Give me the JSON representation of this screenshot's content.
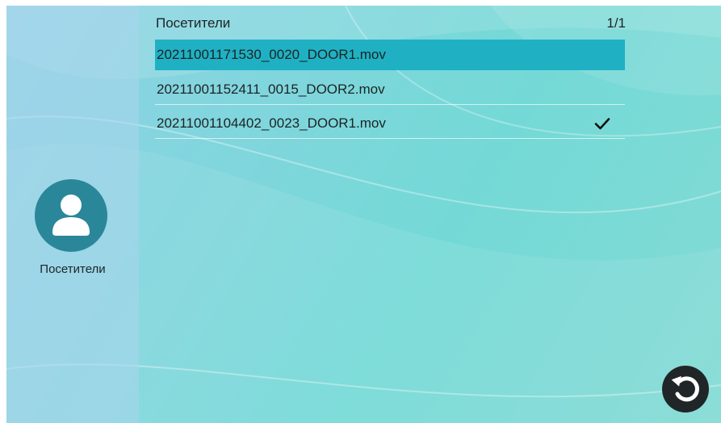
{
  "sidebar": {
    "icon": "person-icon",
    "label": "Посетители"
  },
  "list": {
    "title": "Посетители",
    "page_indicator": "1/1",
    "items": [
      {
        "filename": "20211001171530_0020_DOOR1.mov",
        "selected": true,
        "checked": false
      },
      {
        "filename": "20211001152411_0015_DOOR2.mov",
        "selected": false,
        "checked": false
      },
      {
        "filename": "20211001104402_0023_DOOR1.mov",
        "selected": false,
        "checked": true
      }
    ]
  },
  "controls": {
    "back_icon": "undo-back-icon"
  },
  "colors": {
    "selection": "#1fb1c3",
    "avatar_bg": "#2a8799",
    "back_button_bg": "#202628"
  }
}
